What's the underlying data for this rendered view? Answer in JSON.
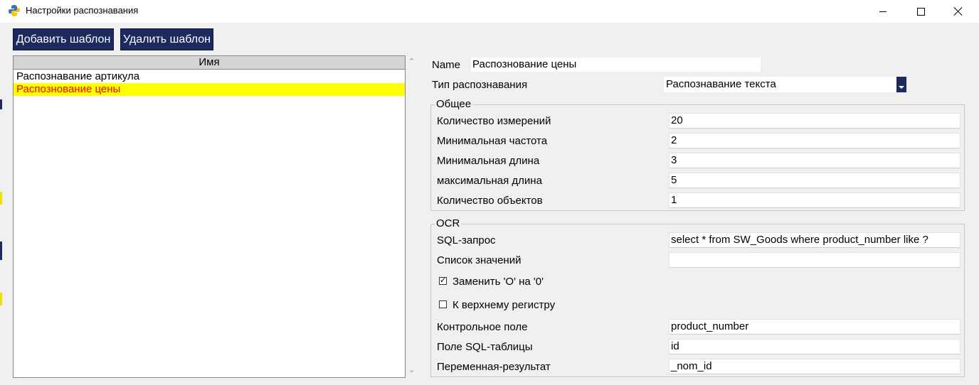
{
  "window": {
    "title": "Настройки распознавания"
  },
  "toolbar": {
    "add_label": "Добавить шаблон",
    "delete_label": "Удалить шаблон"
  },
  "list": {
    "header": "Имя",
    "items": [
      {
        "label": "Распознавание артикула",
        "selected": false
      },
      {
        "label": "Распознование цены",
        "selected": true
      }
    ]
  },
  "form": {
    "name_label": "Name",
    "name_value": "Распознование цены",
    "type_label": "Тип распознавания",
    "type_value": "Распознавание текста"
  },
  "general": {
    "title": "Общее",
    "fields": [
      {
        "label": "Количество измерений",
        "value": "20"
      },
      {
        "label": "Минимальная частота",
        "value": "2"
      },
      {
        "label": "Минимальная длина",
        "value": "3"
      },
      {
        "label": "максимальная длина",
        "value": "5"
      },
      {
        "label": "Количество объектов",
        "value": "1"
      }
    ]
  },
  "ocr": {
    "title": "OCR",
    "sql_label": "SQL-запрос",
    "sql_value": "select * from SW_Goods where product_number like  ?",
    "values_label": "Список значений",
    "values_value": "",
    "replace_label": "Заменить 'O' на '0'",
    "replace_checked": true,
    "upper_label": "К верхнему регистру",
    "upper_checked": false,
    "control_label": "Контрольное поле",
    "control_value": "product_number",
    "table_field_label": "Поле SQL-таблицы",
    "table_field_value": "id",
    "result_label": "Переменная-результат",
    "result_value": "_nom_id"
  },
  "colors": {
    "button_bg": "#1c2a5f",
    "selection_bg": "#ffff00",
    "selection_text": "#ff0000"
  }
}
